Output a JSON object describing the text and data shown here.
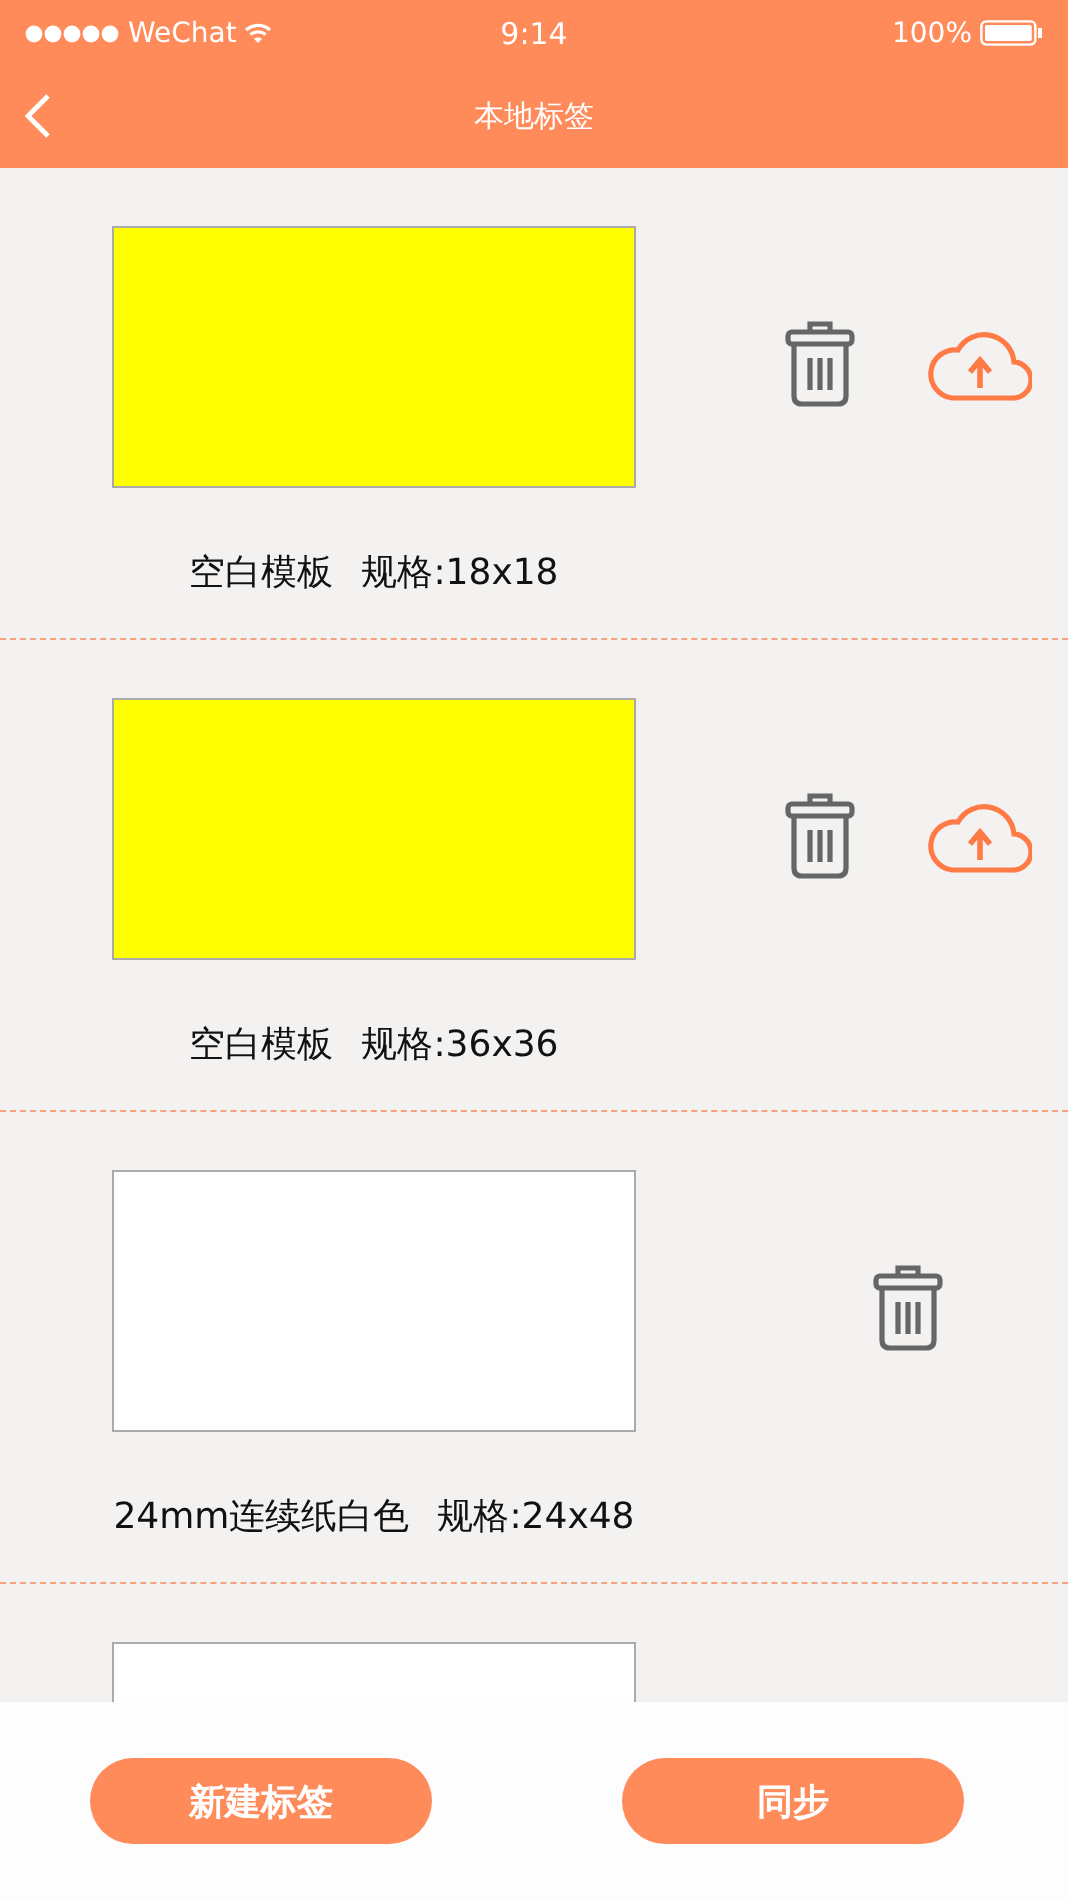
{
  "status_bar": {
    "carrier": "WeChat",
    "time": "9:14",
    "battery": "100%"
  },
  "nav": {
    "title": "本地标签"
  },
  "labels": [
    {
      "name": "空白模板",
      "spec": "规格:18x18",
      "color": "#ffff00",
      "uploadable": true
    },
    {
      "name": "空白模板",
      "spec": "规格:36x36",
      "color": "#ffff00",
      "uploadable": true
    },
    {
      "name": "24mm连续纸白色",
      "spec": "规格:24x48",
      "color": "#ffffff",
      "uploadable": false
    },
    {
      "color": "#ffffff"
    }
  ],
  "buttons": [
    "新建标签",
    "同步"
  ]
}
